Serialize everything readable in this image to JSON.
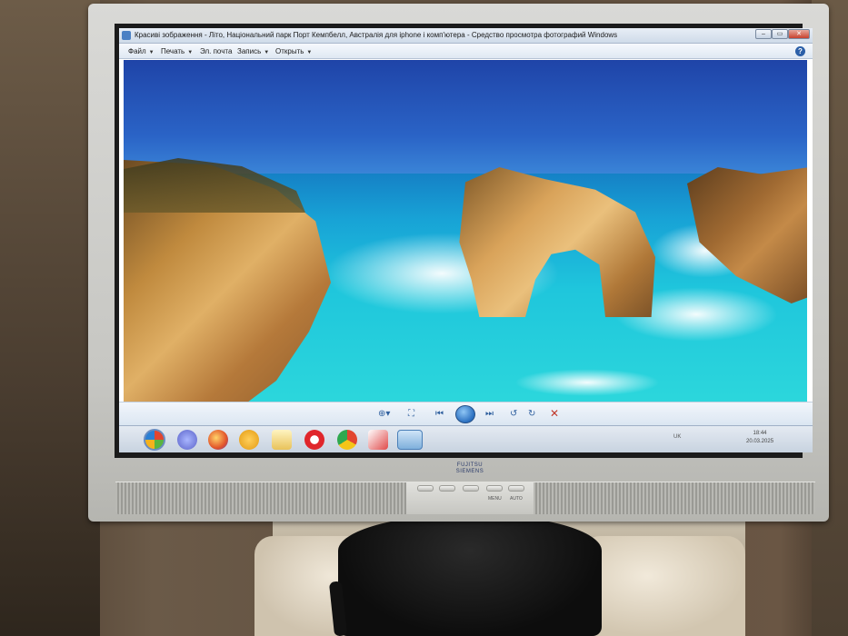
{
  "window": {
    "title": "Красиві зображення - Літо, Національний парк Порт Кемпбелл, Австралія для iphone і комп'ютера - Средство просмотра фотографий Windows",
    "minimize": "–",
    "maximize": "▭",
    "close": "✕"
  },
  "menu": {
    "file": "Файл",
    "print": "Печать",
    "email": "Эл. почта",
    "burn": "Запись",
    "open": "Открыть",
    "help": "?"
  },
  "viewer_toolbar": {
    "zoom": "⊕▾",
    "fit": "⛶",
    "prev": "⏮",
    "next": "⏭",
    "rotate_left": "↺",
    "rotate_right": "↻",
    "delete": "✕"
  },
  "taskbar": {
    "tray_lang": "UK",
    "clock_time": "18:44",
    "clock_date": "20.03.2025"
  },
  "monitor": {
    "brand": "FUJITSU SIEMENS",
    "menu_label": "MENU",
    "auto_label": "AUTO"
  },
  "colors": {
    "sky": "#2a63c6",
    "sea": "#1fc6dc",
    "cliff": "#d9a35a",
    "bezel": "#c7c7c3"
  }
}
